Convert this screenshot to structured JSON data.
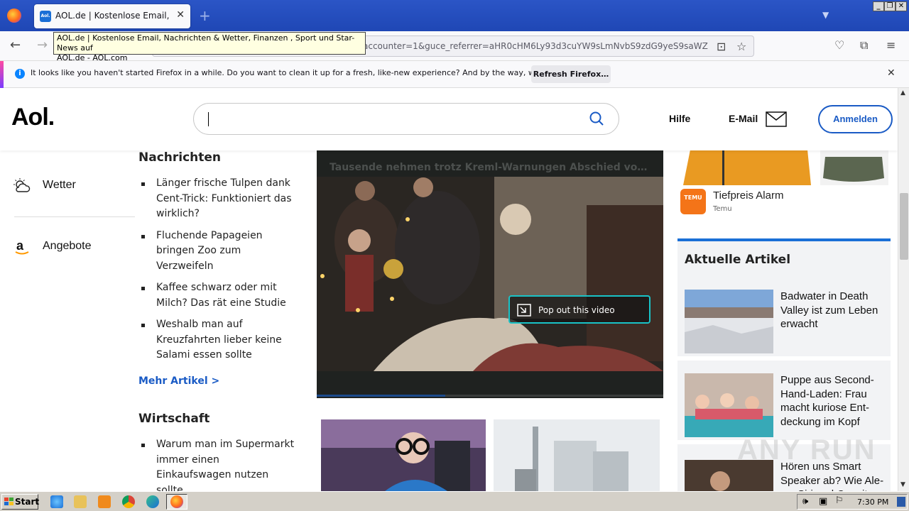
{
  "browser": {
    "tab_title": "AOL.de | Kostenlose Email, Nachrichten & Wetter, Finanzen , Sport und Star-News auf AOL.de - AOL.com",
    "tab_favicon_text": "Aol.",
    "new_tab": "+",
    "tab_close": "✕",
    "url": "accounter=1&guce_referrer=aHR0cHM6Ly93d3cuYW9sLmNvbS9zdG9yeS9saWZlL3R2",
    "tooltip_line1": "AOL.de | Kostenlose Email, Nachrichten & Wetter, Finanzen , Sport und Star-News auf",
    "tooltip_line2": "AOL.de - AOL.com",
    "notification": {
      "text": "It looks like you haven't started Firefox in a while. Do you want to clean it up for a fresh, like-new experience? And by the way, welcome back!",
      "button": "Refresh Firefox…",
      "close": "✕"
    }
  },
  "header": {
    "logo": "Aol.",
    "search_value": "",
    "help": "Hilfe",
    "email": "E-Mail",
    "login": "Anmelden"
  },
  "left_nav": [
    {
      "label": "Wetter",
      "icon": "weather-icon"
    },
    {
      "label": "Angebote",
      "icon": "amazon-icon"
    }
  ],
  "news": {
    "title": "Nachrichten",
    "items": [
      "Länger frische Tulpen dank Cent-Trick: Funktioniert das wirklich?",
      "Fluchende Papageien bringen Zoo zum Verzweifeln",
      "Kaffee schwarz oder mit Milch? Das rät eine Studie",
      "Weshalb man auf Kreuzfahrten lieber keine Salami essen sollte"
    ],
    "more": "Mehr Artikel >"
  },
  "economy": {
    "title": "Wirtschaft",
    "items": [
      "Warum man im Supermarkt immer einen Einkaufswagen nutzen sollte"
    ]
  },
  "video": {
    "title": "Tausende nehmen trotz Kreml-Warnungen Abschied von Nawalny",
    "popout": "Pop out this video",
    "progress": 0.37
  },
  "ad": {
    "title": "Tiefpreis Alarm",
    "sponsor": "Temu",
    "logo_text": "TEMU"
  },
  "articles": {
    "title": "Aktuelle Artikel",
    "items": [
      {
        "title": "Badwater in Death Valley ist zum Leben erwacht"
      },
      {
        "title": "Puppe aus Second-Hand-Laden: Frau macht kuriose Ent-deckung im Kopf"
      },
      {
        "title": "Hören uns Smart Speaker ab? Wie Ale-xa, Siri und Co mit"
      }
    ]
  },
  "watermark": "ANY RUN",
  "taskbar": {
    "start": "Start",
    "clock": "7:30 PM"
  },
  "colors": {
    "aol_blue": "#1a5bc5",
    "titlebar": "#2b55c6",
    "popout_border": "#19c3c7",
    "temu_orange": "#f47418"
  }
}
